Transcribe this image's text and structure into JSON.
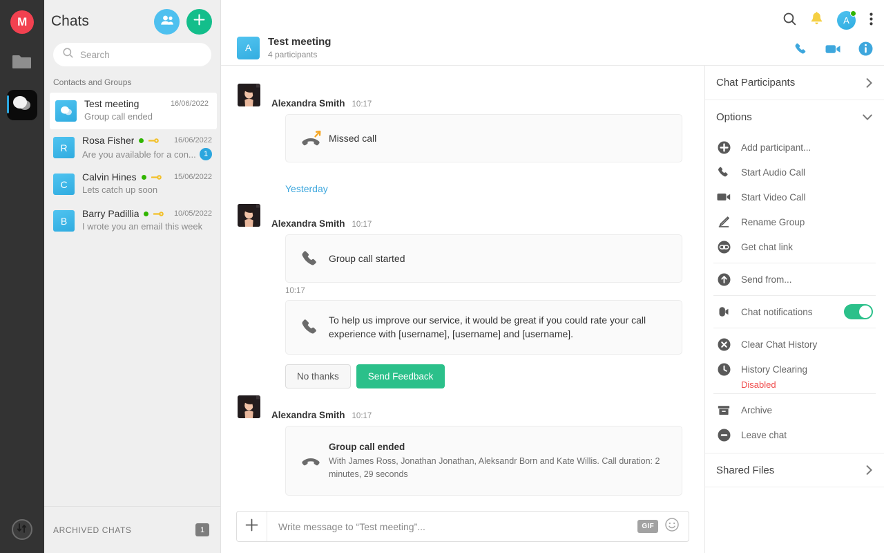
{
  "rail": {
    "logo_text": "M",
    "items": [
      {
        "name": "cloud-drive",
        "icon": "folder-icon"
      },
      {
        "name": "chat",
        "icon": "chat-bubbles-icon",
        "active": true
      }
    ],
    "bottom_icon": "transfers-icon"
  },
  "chat_list": {
    "title": "Chats",
    "add_contact_label": "add-contact",
    "new_chat_label": "new-chat",
    "search": {
      "placeholder": "Search",
      "value": ""
    },
    "section_label": "Contacts and Groups",
    "items": [
      {
        "avatar_letter": "",
        "avatar_type": "group",
        "name": "Test meeting",
        "date": "16/06/2022",
        "preview": "Group call ended",
        "online": false,
        "key": false,
        "unread": "",
        "active": true
      },
      {
        "avatar_letter": "R",
        "avatar_type": "letter",
        "name": "Rosa Fisher",
        "date": "16/06/2022",
        "preview": "Are you available for a con...",
        "online": true,
        "key": true,
        "unread": "1",
        "active": false
      },
      {
        "avatar_letter": "C",
        "avatar_type": "letter",
        "name": "Calvin Hines",
        "date": "15/06/2022",
        "preview": "Lets catch up soon",
        "online": true,
        "key": true,
        "unread": "",
        "active": false
      },
      {
        "avatar_letter": "B",
        "avatar_type": "letter",
        "name": "Barry Padillia",
        "date": "10/05/2022",
        "preview": "I wrote you an email this week",
        "online": true,
        "key": true,
        "unread": "",
        "active": false
      }
    ],
    "archived": {
      "label": "ARCHIVED CHATS",
      "count": "1"
    }
  },
  "top_bar": {
    "icons": [
      "search-icon",
      "bell-icon",
      "avatar",
      "more-vertical-icon"
    ],
    "avatar_letter": "A",
    "avatar_status": "online",
    "call_icons": [
      "phone-icon",
      "video-icon",
      "info-icon"
    ]
  },
  "chat_header": {
    "avatar_letter": "A",
    "title": "Test meeting",
    "subtitle": "4 participants"
  },
  "conversation": {
    "day_divider": "Yesterday",
    "messages": [
      {
        "author": "Alexandra Smith",
        "time": "10:17",
        "icon": "missed-call-icon",
        "text": "Missed call",
        "show_avatar": true
      },
      {
        "author": "Alexandra Smith",
        "time": "10:17",
        "icon": "phone-icon",
        "text": "Group call started",
        "show_avatar": true
      },
      {
        "author": "",
        "time": "10:17",
        "icon": "phone-icon",
        "text": "To help us improve our service, it would be great if you could rate your call experience with [username], [username] and [username].",
        "show_avatar": false
      },
      {
        "author": "Alexandra Smith",
        "time": "10:17",
        "icon": "call-ended-icon",
        "title": "Group call ended",
        "text": "With James Ross, Jonathan Jonathan, Aleksandr Born and Kate Willis. Call duration: 2 minutes, 29 seconds",
        "show_avatar": true
      }
    ],
    "feedback": {
      "decline_label": "No thanks",
      "submit_label": "Send Feedback"
    }
  },
  "composer": {
    "placeholder": "Write message to “Test meeting”...",
    "value": "",
    "gif_label": "GIF",
    "plus_label": "attach",
    "emoji_label": "emoji"
  },
  "right_panel": {
    "participants_title": "Chat Participants",
    "options_title": "Options",
    "shared_files_title": "Shared Files",
    "options": [
      {
        "label": "Add participant...",
        "icon": "add-participant-icon",
        "type": "item"
      },
      {
        "label": "Start Audio Call",
        "icon": "phone-icon",
        "type": "item"
      },
      {
        "label": "Start Video Call",
        "icon": "video-icon",
        "type": "item"
      },
      {
        "label": "Rename Group",
        "icon": "pencil-icon",
        "type": "item"
      },
      {
        "label": "Get chat link",
        "icon": "link-icon",
        "type": "item"
      },
      {
        "type": "separator"
      },
      {
        "label": "Send from...",
        "icon": "upload-icon",
        "type": "item"
      },
      {
        "type": "separator"
      },
      {
        "label": "Chat notifications",
        "icon": "bell-filled-icon",
        "type": "toggle",
        "toggle_on": true
      },
      {
        "type": "separator"
      },
      {
        "label": "Clear Chat History",
        "icon": "clear-icon",
        "type": "item"
      },
      {
        "label": "History Clearing",
        "icon": "clock-icon",
        "type": "item",
        "status": "Disabled"
      },
      {
        "type": "separator"
      },
      {
        "label": "Archive",
        "icon": "archive-icon",
        "type": "item"
      },
      {
        "label": "Leave chat",
        "icon": "leave-icon",
        "type": "item"
      }
    ]
  },
  "colors": {
    "accent_blue": "#2ba6de",
    "accent_green": "#2bc08a",
    "brand_red": "#f24150",
    "warn_orange": "#f5a623",
    "danger_red": "#f04a4a",
    "rail_bg": "#333333",
    "list_bg": "#efefef"
  }
}
